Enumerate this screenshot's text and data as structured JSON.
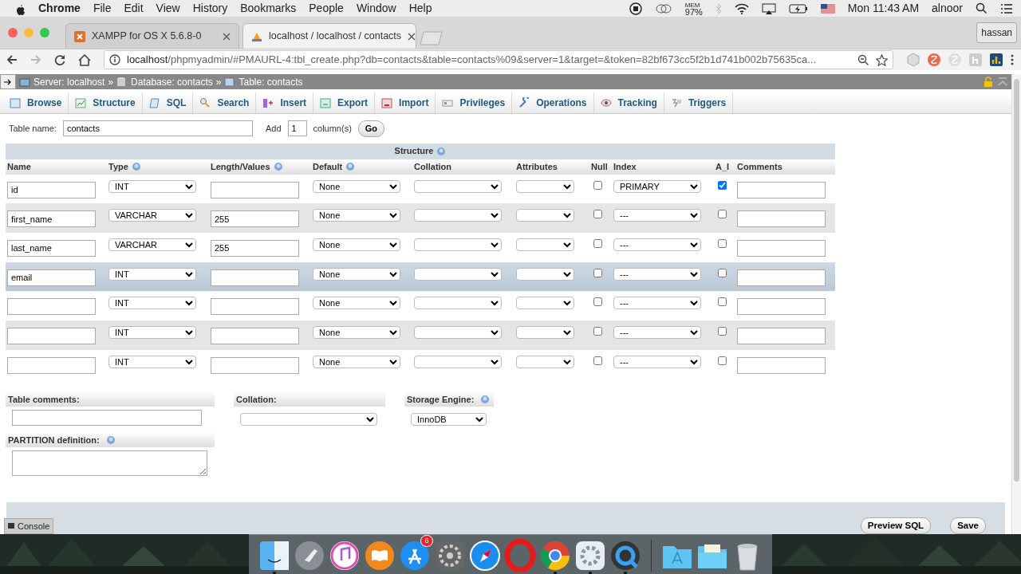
{
  "menubar": {
    "app": "Chrome",
    "menus": [
      "File",
      "Edit",
      "View",
      "History",
      "Bookmarks",
      "People",
      "Window",
      "Help"
    ],
    "mem_label": "MEM",
    "mem_value": "97%",
    "clock": "Mon 11:43 AM",
    "user": "alnoor"
  },
  "browser": {
    "tabs": [
      {
        "title": "XAMPP for OS X 5.6.8-0",
        "selected": false,
        "kind": "xampp"
      },
      {
        "title": "localhost / localhost / contacts",
        "selected": true,
        "kind": "pma"
      }
    ],
    "profile": "hassan",
    "address": {
      "host": "localhost",
      "path": "/phpmyadmin/#PMAURL-4:tbl_create.php?db=contacts&table=contacts%09&server=1&target=&token=82bf673cc5f2b1d741b002b75635ca..."
    }
  },
  "pma": {
    "breadcrumb": [
      {
        "label": "Server: localhost",
        "kind": "server"
      },
      {
        "label": "Database: contacts",
        "kind": "database"
      },
      {
        "label": "Table: contacts",
        "kind": "table"
      }
    ],
    "separator": "»",
    "tabs": [
      {
        "label": "Browse",
        "kind": "browse",
        "selected": false
      },
      {
        "label": "Structure",
        "kind": "structure",
        "selected": false
      },
      {
        "label": "SQL",
        "kind": "sql",
        "selected": false
      },
      {
        "label": "Search",
        "kind": "search",
        "selected": false
      },
      {
        "label": "Insert",
        "kind": "insert",
        "selected": false
      },
      {
        "label": "Export",
        "kind": "export",
        "selected": false
      },
      {
        "label": "Import",
        "kind": "import",
        "selected": false
      },
      {
        "label": "Privileges",
        "kind": "privileges",
        "selected": false
      },
      {
        "label": "Operations",
        "kind": "operations",
        "selected": false
      },
      {
        "label": "Tracking",
        "kind": "tracking",
        "selected": false
      },
      {
        "label": "Triggers",
        "kind": "triggers",
        "selected": false
      }
    ],
    "table_name_label": "Table name:",
    "table_name": "contacts",
    "add_label": "Add",
    "add_count": "1",
    "add_suffix": "column(s)",
    "go": "Go",
    "structure_title": "Structure",
    "columns": [
      {
        "label": "Name",
        "help": false
      },
      {
        "label": "Type",
        "help": true
      },
      {
        "label": "Length/Values",
        "help": true
      },
      {
        "label": "Default",
        "help": true
      },
      {
        "label": "Collation",
        "help": false
      },
      {
        "label": "Attributes",
        "help": false
      },
      {
        "label": "Null",
        "help": false
      },
      {
        "label": "Index",
        "help": false
      },
      {
        "label": "A_I",
        "help": false
      },
      {
        "label": "Comments",
        "help": false
      }
    ],
    "rows": [
      {
        "name": "id",
        "type": "INT",
        "default": "None",
        "index": "PRIMARY",
        "null": false,
        "ai": true,
        "hovered": false
      },
      {
        "name": "first_name",
        "type": "VARCHAR",
        "length": "255",
        "default": "None",
        "index": "---",
        "null": false,
        "ai": false,
        "hovered": false
      },
      {
        "name": "last_name",
        "type": "VARCHAR",
        "length": "255",
        "default": "None",
        "index": "---",
        "null": false,
        "ai": false,
        "hovered": false
      },
      {
        "name": "email",
        "type": "INT",
        "default": "None",
        "index": "---",
        "null": false,
        "ai": false,
        "hovered": true
      },
      {
        "type": "INT",
        "default": "None",
        "index": "---",
        "null": false,
        "ai": false,
        "hovered": false
      },
      {
        "type": "INT",
        "default": "None",
        "index": "---",
        "null": false,
        "ai": false,
        "hovered": false
      },
      {
        "type": "INT",
        "default": "None",
        "index": "---",
        "null": false,
        "ai": false,
        "hovered": false
      }
    ],
    "table_comments_label": "Table comments:",
    "collation_label": "Collation:",
    "storage_engine_label": "Storage Engine:",
    "storage_engine": "InnoDB",
    "partition_label": "PARTITION definition:",
    "console": "Console",
    "buttons": [
      "Preview SQL",
      "Save"
    ]
  },
  "dock": {
    "items": [
      {
        "kind": "finder",
        "running": true
      },
      {
        "kind": "rocket",
        "running": false
      },
      {
        "kind": "music",
        "running": false
      },
      {
        "kind": "book",
        "running": false
      },
      {
        "kind": "store",
        "running": false,
        "badge": "6"
      },
      {
        "kind": "settings",
        "running": false
      },
      {
        "kind": "compass",
        "running": false
      },
      {
        "kind": "ring",
        "running": false
      },
      {
        "kind": "wheel",
        "running": true
      },
      {
        "kind": "gearapp",
        "running": true
      },
      {
        "kind": "lens",
        "running": true
      },
      {
        "kind": "separator"
      },
      {
        "kind": "folder",
        "running": false
      },
      {
        "kind": "docs",
        "running": false
      },
      {
        "kind": "trash",
        "running": false
      }
    ]
  }
}
